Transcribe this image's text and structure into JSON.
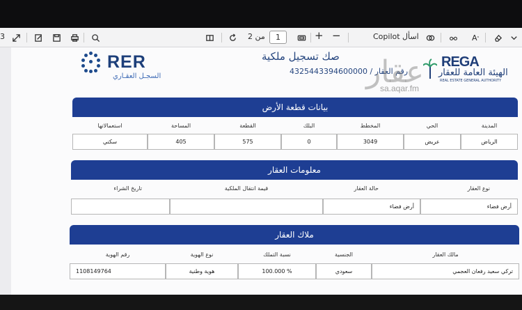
{
  "toolbar": {
    "page_current": "1",
    "page_of": "من 2",
    "copilot_label": "اسأل Copilot",
    "zoom_in": "+",
    "zoom_out": "−",
    "left_digit": "3"
  },
  "header": {
    "rer_logo_text": "RER",
    "rer_subtitle": "السجـل العقـاري",
    "title": "صك تسجيل ملكية",
    "deed_number_label": "رقم العقار / 4325443394600000",
    "rega_name": "REGA",
    "rega_arabic": "الهيئة العامة للعقار",
    "rega_english": "REAL ESTATE GENERAL AUTHORITY"
  },
  "watermark": {
    "text": "عقار",
    "url": "sa.aqar.fm"
  },
  "land": {
    "title": "بيانات قطعة الأرض",
    "headers": [
      "المدينة",
      "الحي",
      "المخطط",
      "البلك",
      "القطعة",
      "المساحة",
      "استعمالاتها"
    ],
    "values": [
      "الرياض",
      "عريض",
      "3049",
      "0",
      "575",
      "405",
      "سكني"
    ]
  },
  "property": {
    "title": "معلومات العقار",
    "headers": [
      "نوع العقار",
      "حالة العقار",
      "قيمة انتقال الملكية",
      "تاريخ الشراء"
    ],
    "values": [
      "أرض فضاء",
      "أرض فضاء",
      "",
      ""
    ]
  },
  "owners": {
    "title": "ملاك العقار",
    "headers": [
      "مالك العقار",
      "الجنسية",
      "نسبة التملك",
      "نوع الهوية",
      "رقم الهوية"
    ],
    "values": [
      "تركي سعيد رفعان العجمي",
      "سعودي",
      "% 100.000",
      "هوية وطنية",
      "1108149764"
    ]
  },
  "colors": {
    "section_header": "#1e3e93",
    "brand_navy": "#1f3e78",
    "toolbar_bg": "#f3f3f4"
  }
}
